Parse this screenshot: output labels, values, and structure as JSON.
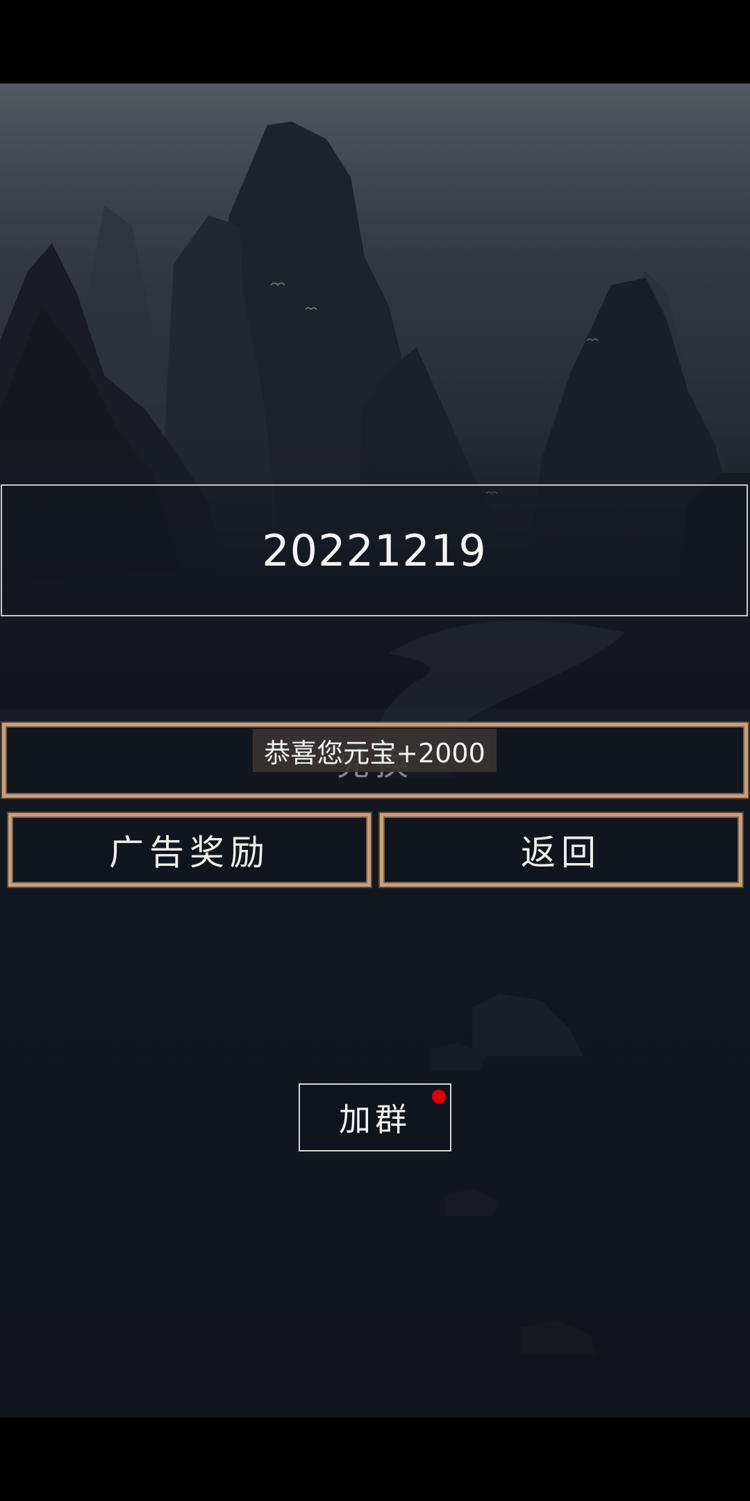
{
  "redeem": {
    "code_value": "20221219",
    "redeem_label": "兑换"
  },
  "toast": {
    "message": "恭喜您元宝+2000"
  },
  "actions": {
    "ad_reward_label": "广告奖励",
    "back_label": "返回",
    "join_group_label": "加群"
  },
  "colors": {
    "button_border": "#c7a07f",
    "notification_dot": "#e00000",
    "background_dark": "#12161c"
  }
}
